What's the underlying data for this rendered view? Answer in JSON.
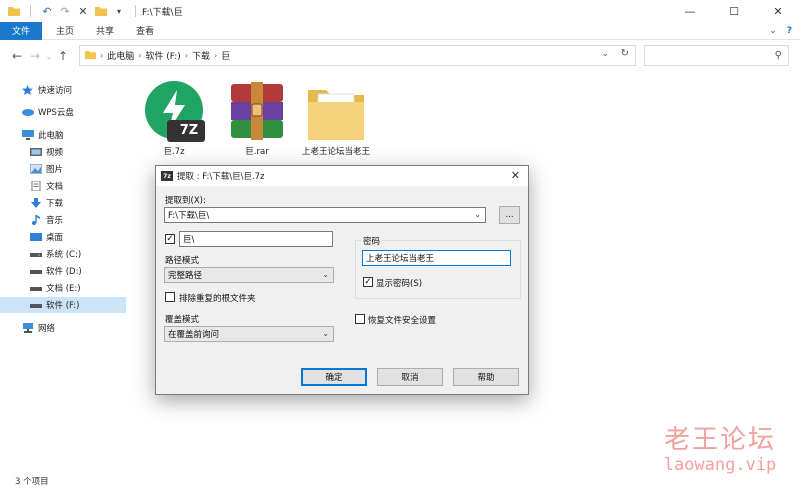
{
  "window": {
    "title": "F:\\下载\\巨",
    "controls": {
      "minimize": "—",
      "maximize": "☐",
      "close": "✕"
    }
  },
  "ribbon": {
    "tabs": [
      "文件",
      "主页",
      "共享",
      "查看"
    ],
    "expand_icon": "chevron-down-icon",
    "help_icon": "?"
  },
  "address": {
    "crumbs": [
      "此电脑",
      "软件 (F:)",
      "下载",
      "巨"
    ],
    "search_placeholder": ""
  },
  "nav": {
    "items": [
      {
        "label": "快速访问",
        "icon": "star-icon",
        "selected": false
      },
      {
        "label": "WPS云盘",
        "icon": "cloud-icon",
        "selected": false
      },
      {
        "label": "此电脑",
        "icon": "computer-icon",
        "selected": false
      },
      {
        "label": "视频",
        "icon": "video-icon",
        "selected": false
      },
      {
        "label": "图片",
        "icon": "picture-icon",
        "selected": false
      },
      {
        "label": "文档",
        "icon": "document-icon",
        "selected": false
      },
      {
        "label": "下载",
        "icon": "download-icon",
        "selected": false
      },
      {
        "label": "音乐",
        "icon": "music-icon",
        "selected": false
      },
      {
        "label": "桌面",
        "icon": "desktop-icon",
        "selected": false
      },
      {
        "label": "系统 (C:)",
        "icon": "drive-icon",
        "selected": false
      },
      {
        "label": "软件 (D:)",
        "icon": "drive-icon",
        "selected": false
      },
      {
        "label": "文档 (E:)",
        "icon": "drive-icon",
        "selected": false
      },
      {
        "label": "软件 (F:)",
        "icon": "drive-icon",
        "selected": true
      },
      {
        "label": "网络",
        "icon": "network-icon",
        "selected": false
      }
    ]
  },
  "files": [
    {
      "name": "巨.7z",
      "badge": "7Z",
      "icon": "7zip-archive-icon"
    },
    {
      "name": "巨.rar",
      "icon": "winrar-archive-icon"
    },
    {
      "name": "上老王论坛当老王",
      "icon": "folder-icon"
    }
  ],
  "status": {
    "count": "3 个项目"
  },
  "dialog": {
    "title": "提取 : F:\\下载\\巨\\巨.7z",
    "extract_to_label": "提取到(X):",
    "extract_to_value": "F:\\下载\\巨\\",
    "browse_label": "...",
    "subfolder_checked": true,
    "subfolder_value": "巨\\",
    "path_mode_label": "路径模式",
    "path_mode_value": "完整路径",
    "exclude_root_label": "排除重复的根文件夹",
    "exclude_root_checked": false,
    "overwrite_label": "覆盖模式",
    "overwrite_value": "在覆盖前询问",
    "password_label": "密码",
    "password_value": "上老王论坛当老王",
    "show_password_label": "显示密码(S)",
    "show_password_checked": true,
    "restore_security_label": "恢复文件安全设置",
    "restore_security_checked": false,
    "ok_label": "确定",
    "cancel_label": "取消",
    "help_label": "帮助"
  },
  "watermark": {
    "line1": "老王论坛",
    "line2": "laowang.vip"
  },
  "colors": {
    "file_tab": "#1979ca",
    "selection": "#cce4f7",
    "watermark": "#f2a0a0"
  }
}
